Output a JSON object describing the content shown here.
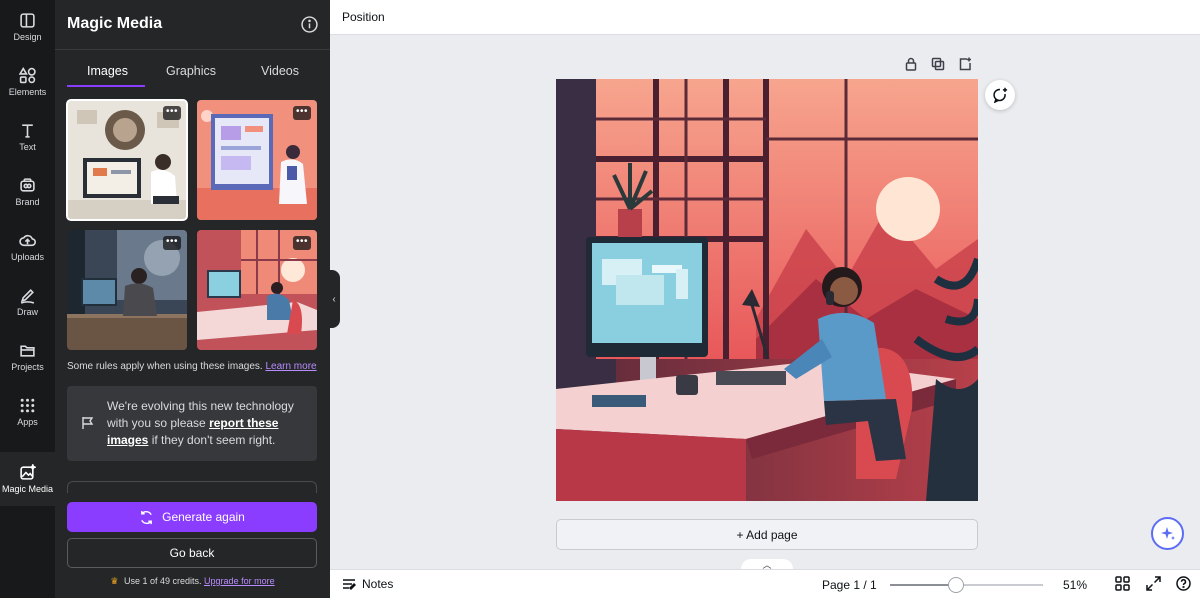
{
  "rail": {
    "items": [
      {
        "label": "Design",
        "icon": "design-icon"
      },
      {
        "label": "Elements",
        "icon": "elements-icon"
      },
      {
        "label": "Text",
        "icon": "text-icon"
      },
      {
        "label": "Brand",
        "icon": "brand-icon"
      },
      {
        "label": "Uploads",
        "icon": "uploads-icon"
      },
      {
        "label": "Draw",
        "icon": "draw-icon"
      },
      {
        "label": "Projects",
        "icon": "projects-icon"
      },
      {
        "label": "Apps",
        "icon": "apps-icon"
      },
      {
        "label": "Magic Media",
        "icon": "magic-media-icon"
      }
    ],
    "active": "Magic Media"
  },
  "panel": {
    "title": "Magic Media",
    "tabs": [
      {
        "label": "Images",
        "active": true
      },
      {
        "label": "Graphics",
        "active": false
      },
      {
        "label": "Videos",
        "active": false
      }
    ],
    "thumb_menu": "•••",
    "rules": {
      "text": "Some rules apply when using these images.",
      "link": "Learn more"
    },
    "notice": {
      "text_before": "We're evolving this new technology with you so please",
      "link": "report these images",
      "text_after": "if they don't seem right."
    },
    "generate_label": "Generate again",
    "go_back_label": "Go back",
    "credits": {
      "text": "Use 1 of 49 credits.",
      "link": "Upgrade for more"
    }
  },
  "topbar": {
    "position_label": "Position"
  },
  "canvas": {
    "add_page_label": "+ Add page"
  },
  "bottombar": {
    "notes_label": "Notes",
    "page_indicator": "Page 1 / 1",
    "zoom_label": "51%",
    "zoom_fraction": 0.43
  },
  "colors": {
    "accent": "#8b3dff",
    "panel_bg": "#252627",
    "rail_bg": "#18191b",
    "canvas_bg": "#ebecf0"
  }
}
